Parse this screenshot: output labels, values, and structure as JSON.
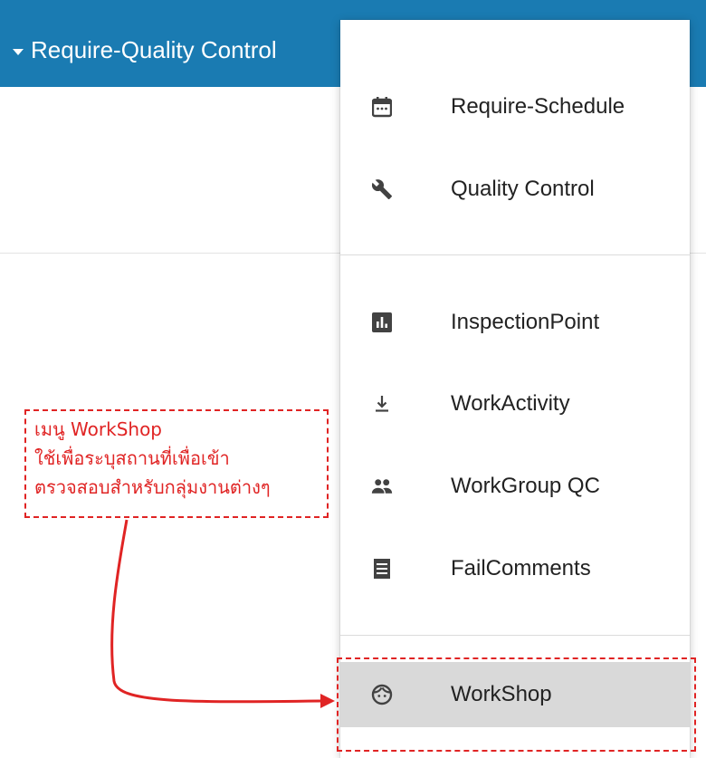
{
  "header": {
    "title": "Require-Quality Control"
  },
  "menu": {
    "items": [
      {
        "label": "Require-Schedule",
        "icon": "calendar-icon"
      },
      {
        "label": "Quality Control",
        "icon": "wrench-icon"
      },
      {
        "label": "InspectionPoint",
        "icon": "bar-chart-icon"
      },
      {
        "label": "WorkActivity",
        "icon": "download-icon"
      },
      {
        "label": "WorkGroup QC",
        "icon": "people-icon"
      },
      {
        "label": "FailComments",
        "icon": "receipt-icon"
      },
      {
        "label": "WorkShop",
        "icon": "face-icon"
      }
    ],
    "selected": "WorkShop"
  },
  "annotation": {
    "line1": "เมนู WorkShop",
    "line2": "ใช้เพื่อระบุสถานที่เพื่อเข้า",
    "line3": "ตรวจสอบสำหรับกลุ่มงานต่างๆ"
  },
  "colors": {
    "header": "#1a7bb2",
    "annotation": "#e02424",
    "selected_item": "#d9d9d9",
    "icon": "#424242"
  }
}
